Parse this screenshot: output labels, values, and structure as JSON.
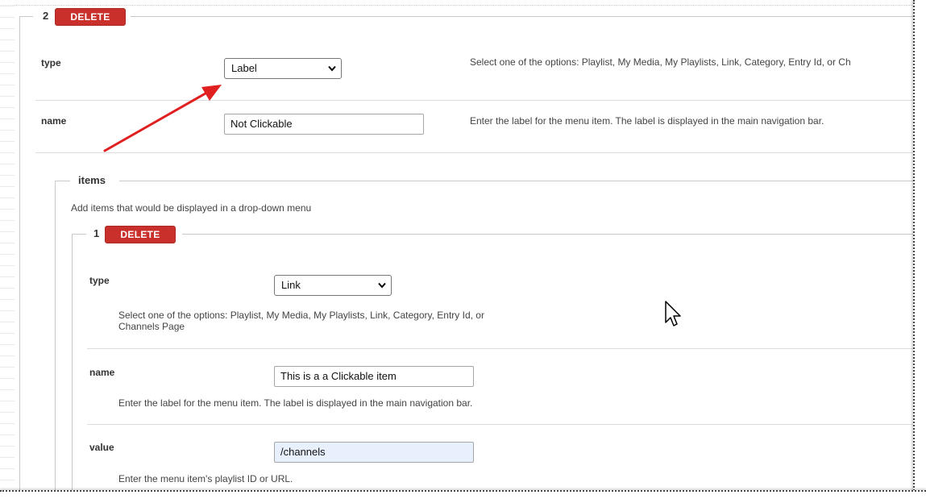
{
  "outer_item": {
    "number": "2",
    "delete_label": "DELETE",
    "type_field": {
      "label": "type",
      "value": "Label",
      "help": "Select one of the options: Playlist, My Media, My Playlists, Link, Category, Entry Id, or Ch"
    },
    "name_field": {
      "label": "name",
      "value": "Not Clickable",
      "help": "Enter the label for the menu item. The label is displayed in the main navigation bar."
    }
  },
  "items_section": {
    "title": "items",
    "description": "Add items that would be displayed in a drop-down menu",
    "item": {
      "number": "1",
      "delete_label": "DELETE",
      "type_field": {
        "label": "type",
        "value": "Link",
        "help_line1": "Select one of the options: Playlist, My Media, My Playlists, Link, Category, Entry Id, or",
        "help_line2": "Channels Page"
      },
      "name_field": {
        "label": "name",
        "value": "This is a a Clickable item",
        "help": "Enter the label for the menu item. The label is displayed in the main navigation bar."
      },
      "value_field": {
        "label": "value",
        "value": "/channels",
        "help": "Enter the menu item's playlist ID or URL."
      }
    }
  },
  "annotation": {
    "arrow_color": "#e02020",
    "cursor_icon": "mouse-pointer-icon"
  }
}
